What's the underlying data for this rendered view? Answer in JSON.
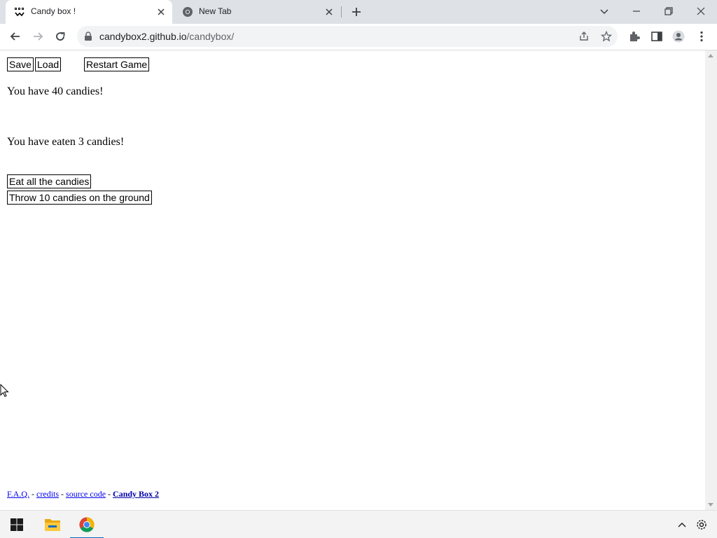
{
  "browser": {
    "tabs": [
      {
        "title": "Candy box !",
        "active": true
      },
      {
        "title": "New Tab",
        "active": false
      }
    ],
    "url_host": "candybox2.github.io",
    "url_path": "/candybox/"
  },
  "game": {
    "buttons": {
      "save": "Save",
      "load": "Load",
      "restart": "Restart Game",
      "eat": "Eat all the candies",
      "throw": "Throw 10 candies on the ground"
    },
    "candies_text": "You have 40 candies!",
    "eaten_text": "You have eaten 3 candies!"
  },
  "footer": {
    "faq": "F.A.Q.",
    "sep1": " - ",
    "credits": "credits",
    "sep2": " - ",
    "source_code": "source code",
    "sep3": " - ",
    "candybox2": "Candy Box 2"
  },
  "colors": {
    "tabstrip_bg": "#dee1e6",
    "link": "#0000ee",
    "taskbar_accent": "#0067c0"
  },
  "icons": {
    "tab1_favicon": "candybox-face-icon",
    "tab2_favicon": "chrome-icon",
    "taskbar": [
      "windows-start-icon",
      "file-explorer-icon",
      "chrome-icon"
    ],
    "tray": [
      "chevron-up-icon",
      "settings-gear-icon"
    ]
  }
}
